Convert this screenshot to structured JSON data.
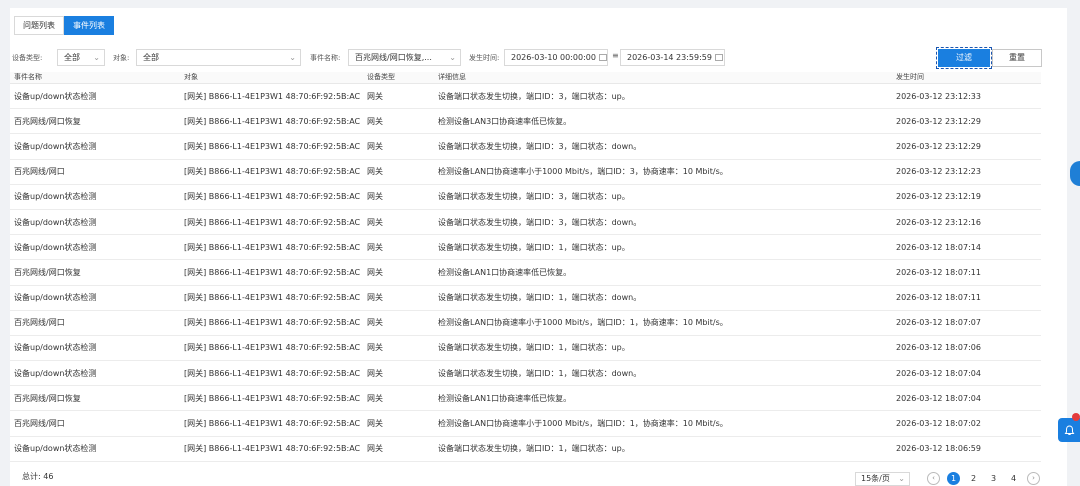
{
  "tabs": [
    {
      "label": "问题列表",
      "active": false
    },
    {
      "label": "事件列表",
      "active": true
    }
  ],
  "filters": {
    "device_type_label": "设备类型:",
    "device_type_value": "全部",
    "object_label": "对象:",
    "object_value": "全部",
    "event_name_label": "事件名称:",
    "event_name_value": "百兆网线/网口恢复,...",
    "time_label": "发生时间:",
    "time_start": "2026-03-10 00:00:00",
    "range_sep": "≡",
    "time_end": "2026-03-14 23:59:59",
    "filter_button": "过滤",
    "reset_button": "重置"
  },
  "table": {
    "headers": [
      "事件名称",
      "对象",
      "设备类型",
      "详细信息",
      "发生时间"
    ],
    "rows": [
      [
        "设备up/down状态检测",
        "[网关] B866-L1-4E1P3W1 48:70:6F:92:5B:AC",
        "网关",
        "设备端口状态发生切换，端口ID：3，端口状态：up。",
        "2026-03-12 23:12:33"
      ],
      [
        "百兆网线/网口恢复",
        "[网关] B866-L1-4E1P3W1 48:70:6F:92:5B:AC",
        "网关",
        "检测设备LAN3口协商速率低已恢复。",
        "2026-03-12 23:12:29"
      ],
      [
        "设备up/down状态检测",
        "[网关] B866-L1-4E1P3W1 48:70:6F:92:5B:AC",
        "网关",
        "设备端口状态发生切换，端口ID：3，端口状态：down。",
        "2026-03-12 23:12:29"
      ],
      [
        "百兆网线/网口",
        "[网关] B866-L1-4E1P3W1 48:70:6F:92:5B:AC",
        "网关",
        "检测设备LAN口协商速率小于1000 Mbit/s，端口ID：3，协商速率：10 Mbit/s。",
        "2026-03-12 23:12:23"
      ],
      [
        "设备up/down状态检测",
        "[网关] B866-L1-4E1P3W1 48:70:6F:92:5B:AC",
        "网关",
        "设备端口状态发生切换，端口ID：3，端口状态：up。",
        "2026-03-12 23:12:19"
      ],
      [
        "设备up/down状态检测",
        "[网关] B866-L1-4E1P3W1 48:70:6F:92:5B:AC",
        "网关",
        "设备端口状态发生切换，端口ID：3，端口状态：down。",
        "2026-03-12 23:12:16"
      ],
      [
        "设备up/down状态检测",
        "[网关] B866-L1-4E1P3W1 48:70:6F:92:5B:AC",
        "网关",
        "设备端口状态发生切换，端口ID：1，端口状态：up。",
        "2026-03-12 18:07:14"
      ],
      [
        "百兆网线/网口恢复",
        "[网关] B866-L1-4E1P3W1 48:70:6F:92:5B:AC",
        "网关",
        "检测设备LAN1口协商速率低已恢复。",
        "2026-03-12 18:07:11"
      ],
      [
        "设备up/down状态检测",
        "[网关] B866-L1-4E1P3W1 48:70:6F:92:5B:AC",
        "网关",
        "设备端口状态发生切换，端口ID：1，端口状态：down。",
        "2026-03-12 18:07:11"
      ],
      [
        "百兆网线/网口",
        "[网关] B866-L1-4E1P3W1 48:70:6F:92:5B:AC",
        "网关",
        "检测设备LAN口协商速率小于1000 Mbit/s，端口ID：1，协商速率：10 Mbit/s。",
        "2026-03-12 18:07:07"
      ],
      [
        "设备up/down状态检测",
        "[网关] B866-L1-4E1P3W1 48:70:6F:92:5B:AC",
        "网关",
        "设备端口状态发生切换，端口ID：1，端口状态：up。",
        "2026-03-12 18:07:06"
      ],
      [
        "设备up/down状态检测",
        "[网关] B866-L1-4E1P3W1 48:70:6F:92:5B:AC",
        "网关",
        "设备端口状态发生切换，端口ID：1，端口状态：down。",
        "2026-03-12 18:07:04"
      ],
      [
        "百兆网线/网口恢复",
        "[网关] B866-L1-4E1P3W1 48:70:6F:92:5B:AC",
        "网关",
        "检测设备LAN1口协商速率低已恢复。",
        "2026-03-12 18:07:04"
      ],
      [
        "百兆网线/网口",
        "[网关] B866-L1-4E1P3W1 48:70:6F:92:5B:AC",
        "网关",
        "检测设备LAN口协商速率小于1000 Mbit/s，端口ID：1，协商速率：10 Mbit/s。",
        "2026-03-12 18:07:02"
      ],
      [
        "设备up/down状态检测",
        "[网关] B866-L1-4E1P3W1 48:70:6F:92:5B:AC",
        "网关",
        "设备端口状态发生切换，端口ID：1，端口状态：up。",
        "2026-03-12 18:06:59"
      ]
    ]
  },
  "footer": {
    "total": "总计: 46",
    "page_size": "15条/页",
    "pages": [
      "1",
      "2",
      "3",
      "4"
    ],
    "current_page": "1"
  },
  "colors": {
    "primary": "#1a7fe0"
  }
}
